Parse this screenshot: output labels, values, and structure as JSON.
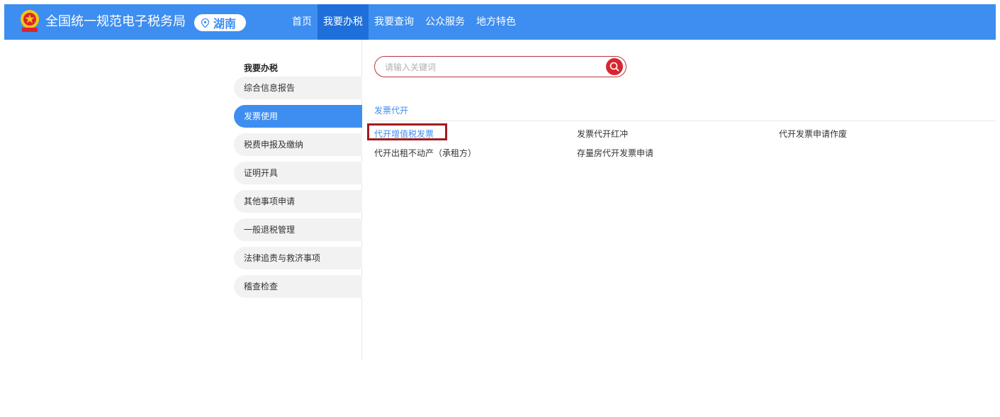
{
  "header": {
    "logo_icon": "tax-emblem-icon",
    "site_title": "全国统一规范电子税务局",
    "region": {
      "icon": "location-pin-icon",
      "label": "湖南"
    },
    "nav": [
      {
        "label": "首页",
        "active": false
      },
      {
        "label": "我要办税",
        "active": true
      },
      {
        "label": "我要查询",
        "active": false
      },
      {
        "label": "公众服务",
        "active": false
      },
      {
        "label": "地方特色",
        "active": false
      }
    ]
  },
  "sidebar": {
    "heading": "我要办税",
    "items": [
      {
        "label": "综合信息报告",
        "active": false
      },
      {
        "label": "发票使用",
        "active": true
      },
      {
        "label": "税费申报及缴纳",
        "active": false
      },
      {
        "label": "证明开具",
        "active": false
      },
      {
        "label": "其他事项申请",
        "active": false
      },
      {
        "label": "一般退税管理",
        "active": false
      },
      {
        "label": "法律追责与救济事项",
        "active": false
      },
      {
        "label": "稽查检查",
        "active": false
      }
    ]
  },
  "search": {
    "placeholder": "请输入关键词",
    "value": "",
    "button_icon": "search-icon"
  },
  "main": {
    "section_title": "发票代开",
    "links": [
      [
        "代开增值税发票",
        "发票代开红冲",
        "代开发票申请作废"
      ],
      [
        "代开出租不动产（承租方）",
        "存量房代开发票申请"
      ]
    ],
    "colors": {
      "primary": "#3d8ef0",
      "search_border": "#b5373b",
      "search_button": "#d8262f",
      "highlight_box": "#a11b1f"
    }
  }
}
